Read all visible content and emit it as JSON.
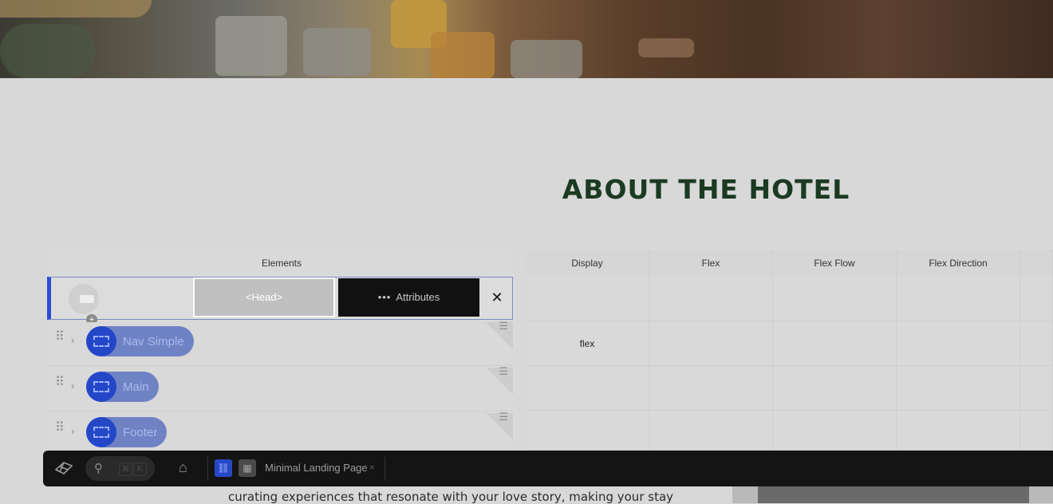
{
  "website": {
    "section_title": "ABOUT THE HOTEL",
    "body_text": "curating experiences that resonate with your love story, making your stay"
  },
  "elements_panel": {
    "header": "Elements",
    "selected_row": {
      "head_button": "<Head>",
      "attributes_button": "Attributes",
      "attributes_icon": "more-dots-icon",
      "close_symbol": "✕",
      "add_symbol": "+"
    },
    "rows": [
      {
        "label": "Nav Simple",
        "display": "flex"
      },
      {
        "label": "Main",
        "display": ""
      },
      {
        "label": "Footer",
        "display": ""
      }
    ],
    "columns": [
      "Display",
      "Flex",
      "Flex Flow",
      "Flex Direction",
      ""
    ]
  },
  "toolbar": {
    "kbd1": "⌘",
    "kbd2": "K",
    "tab_label": "Minimal Landing Page",
    "tab_close": "×"
  },
  "colors": {
    "accent": "#2a4cd6",
    "title": "#1b3a22",
    "toolbar": "#141414"
  }
}
